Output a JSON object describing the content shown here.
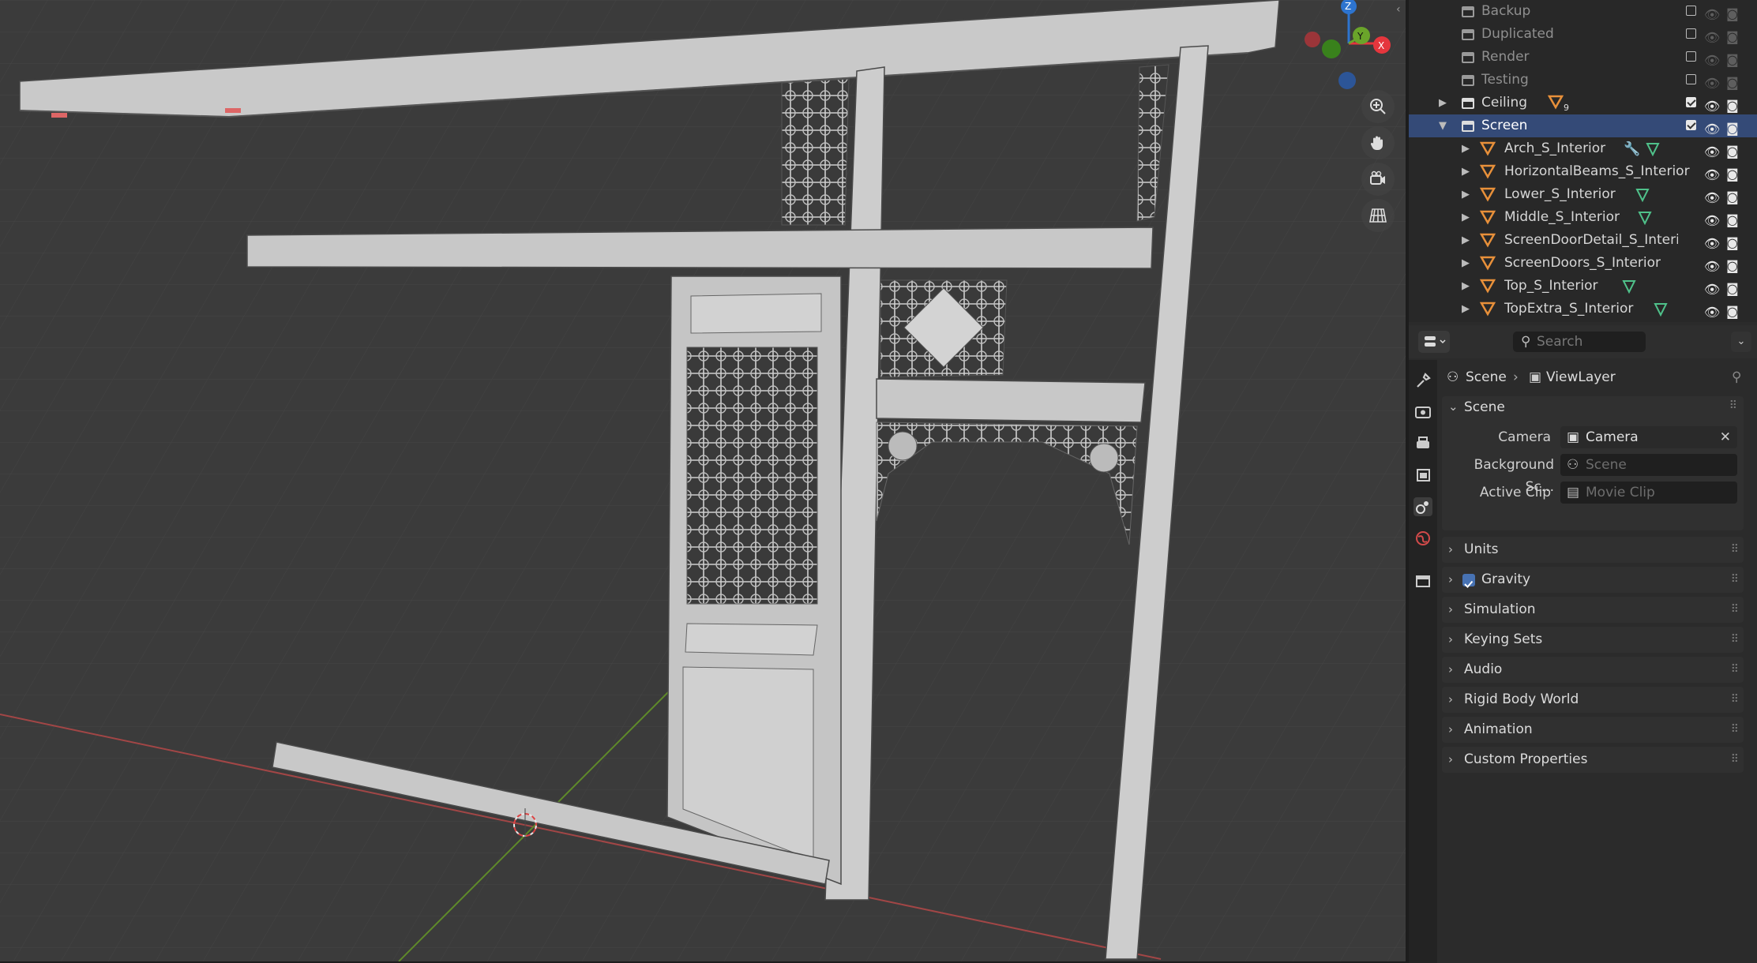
{
  "outliner": {
    "rows": [
      {
        "label": "Backup",
        "kind": "collection",
        "dim": true
      },
      {
        "label": "Duplicated",
        "kind": "collection",
        "dim": true
      },
      {
        "label": "Render",
        "kind": "collection",
        "dim": true
      },
      {
        "label": "Testing",
        "kind": "collection",
        "dim": true
      },
      {
        "label": "Ceiling",
        "kind": "collection",
        "badge": "9"
      },
      {
        "label": "Screen",
        "kind": "collection",
        "selected": true
      },
      {
        "label": "Arch_S_Interior",
        "kind": "mesh"
      },
      {
        "label": "HorizontalBeams_S_Interior",
        "kind": "mesh"
      },
      {
        "label": "Lower_S_Interior",
        "kind": "mesh"
      },
      {
        "label": "Middle_S_Interior",
        "kind": "mesh"
      },
      {
        "label": "ScreenDoorDetail_S_Interior",
        "kind": "mesh"
      },
      {
        "label": "ScreenDoors_S_Interior",
        "kind": "mesh"
      },
      {
        "label": "Top_S_Interior",
        "kind": "mesh"
      },
      {
        "label": "TopExtra_S_Interior",
        "kind": "mesh"
      }
    ]
  },
  "properties": {
    "search_placeholder": "Search",
    "breadcrumb": {
      "scene": "Scene",
      "view_layer": "ViewLayer"
    },
    "scene_panel": {
      "title": "Scene",
      "camera_label": "Camera",
      "camera_value": "Camera",
      "background_label": "Background Sc...",
      "background_placeholder": "Scene",
      "clip_label": "Active Clip",
      "clip_placeholder": "Movie Clip"
    },
    "panels": [
      "Units",
      "Gravity",
      "Simulation",
      "Keying Sets",
      "Audio",
      "Rigid Body World",
      "Animation",
      "Custom Properties"
    ],
    "gravity_enabled": true
  },
  "gizmo": {
    "z": "Z",
    "y": "Y",
    "x": "X"
  },
  "colors": {
    "selection": "#344a77",
    "x_axis": "#e5363d",
    "y_axis": "#6aa42a",
    "z_axis": "#2d74cf",
    "mesh_icon": "#e8903a",
    "modifier_icon": "#5aa0e6",
    "data_icon": "#4fc18a"
  }
}
